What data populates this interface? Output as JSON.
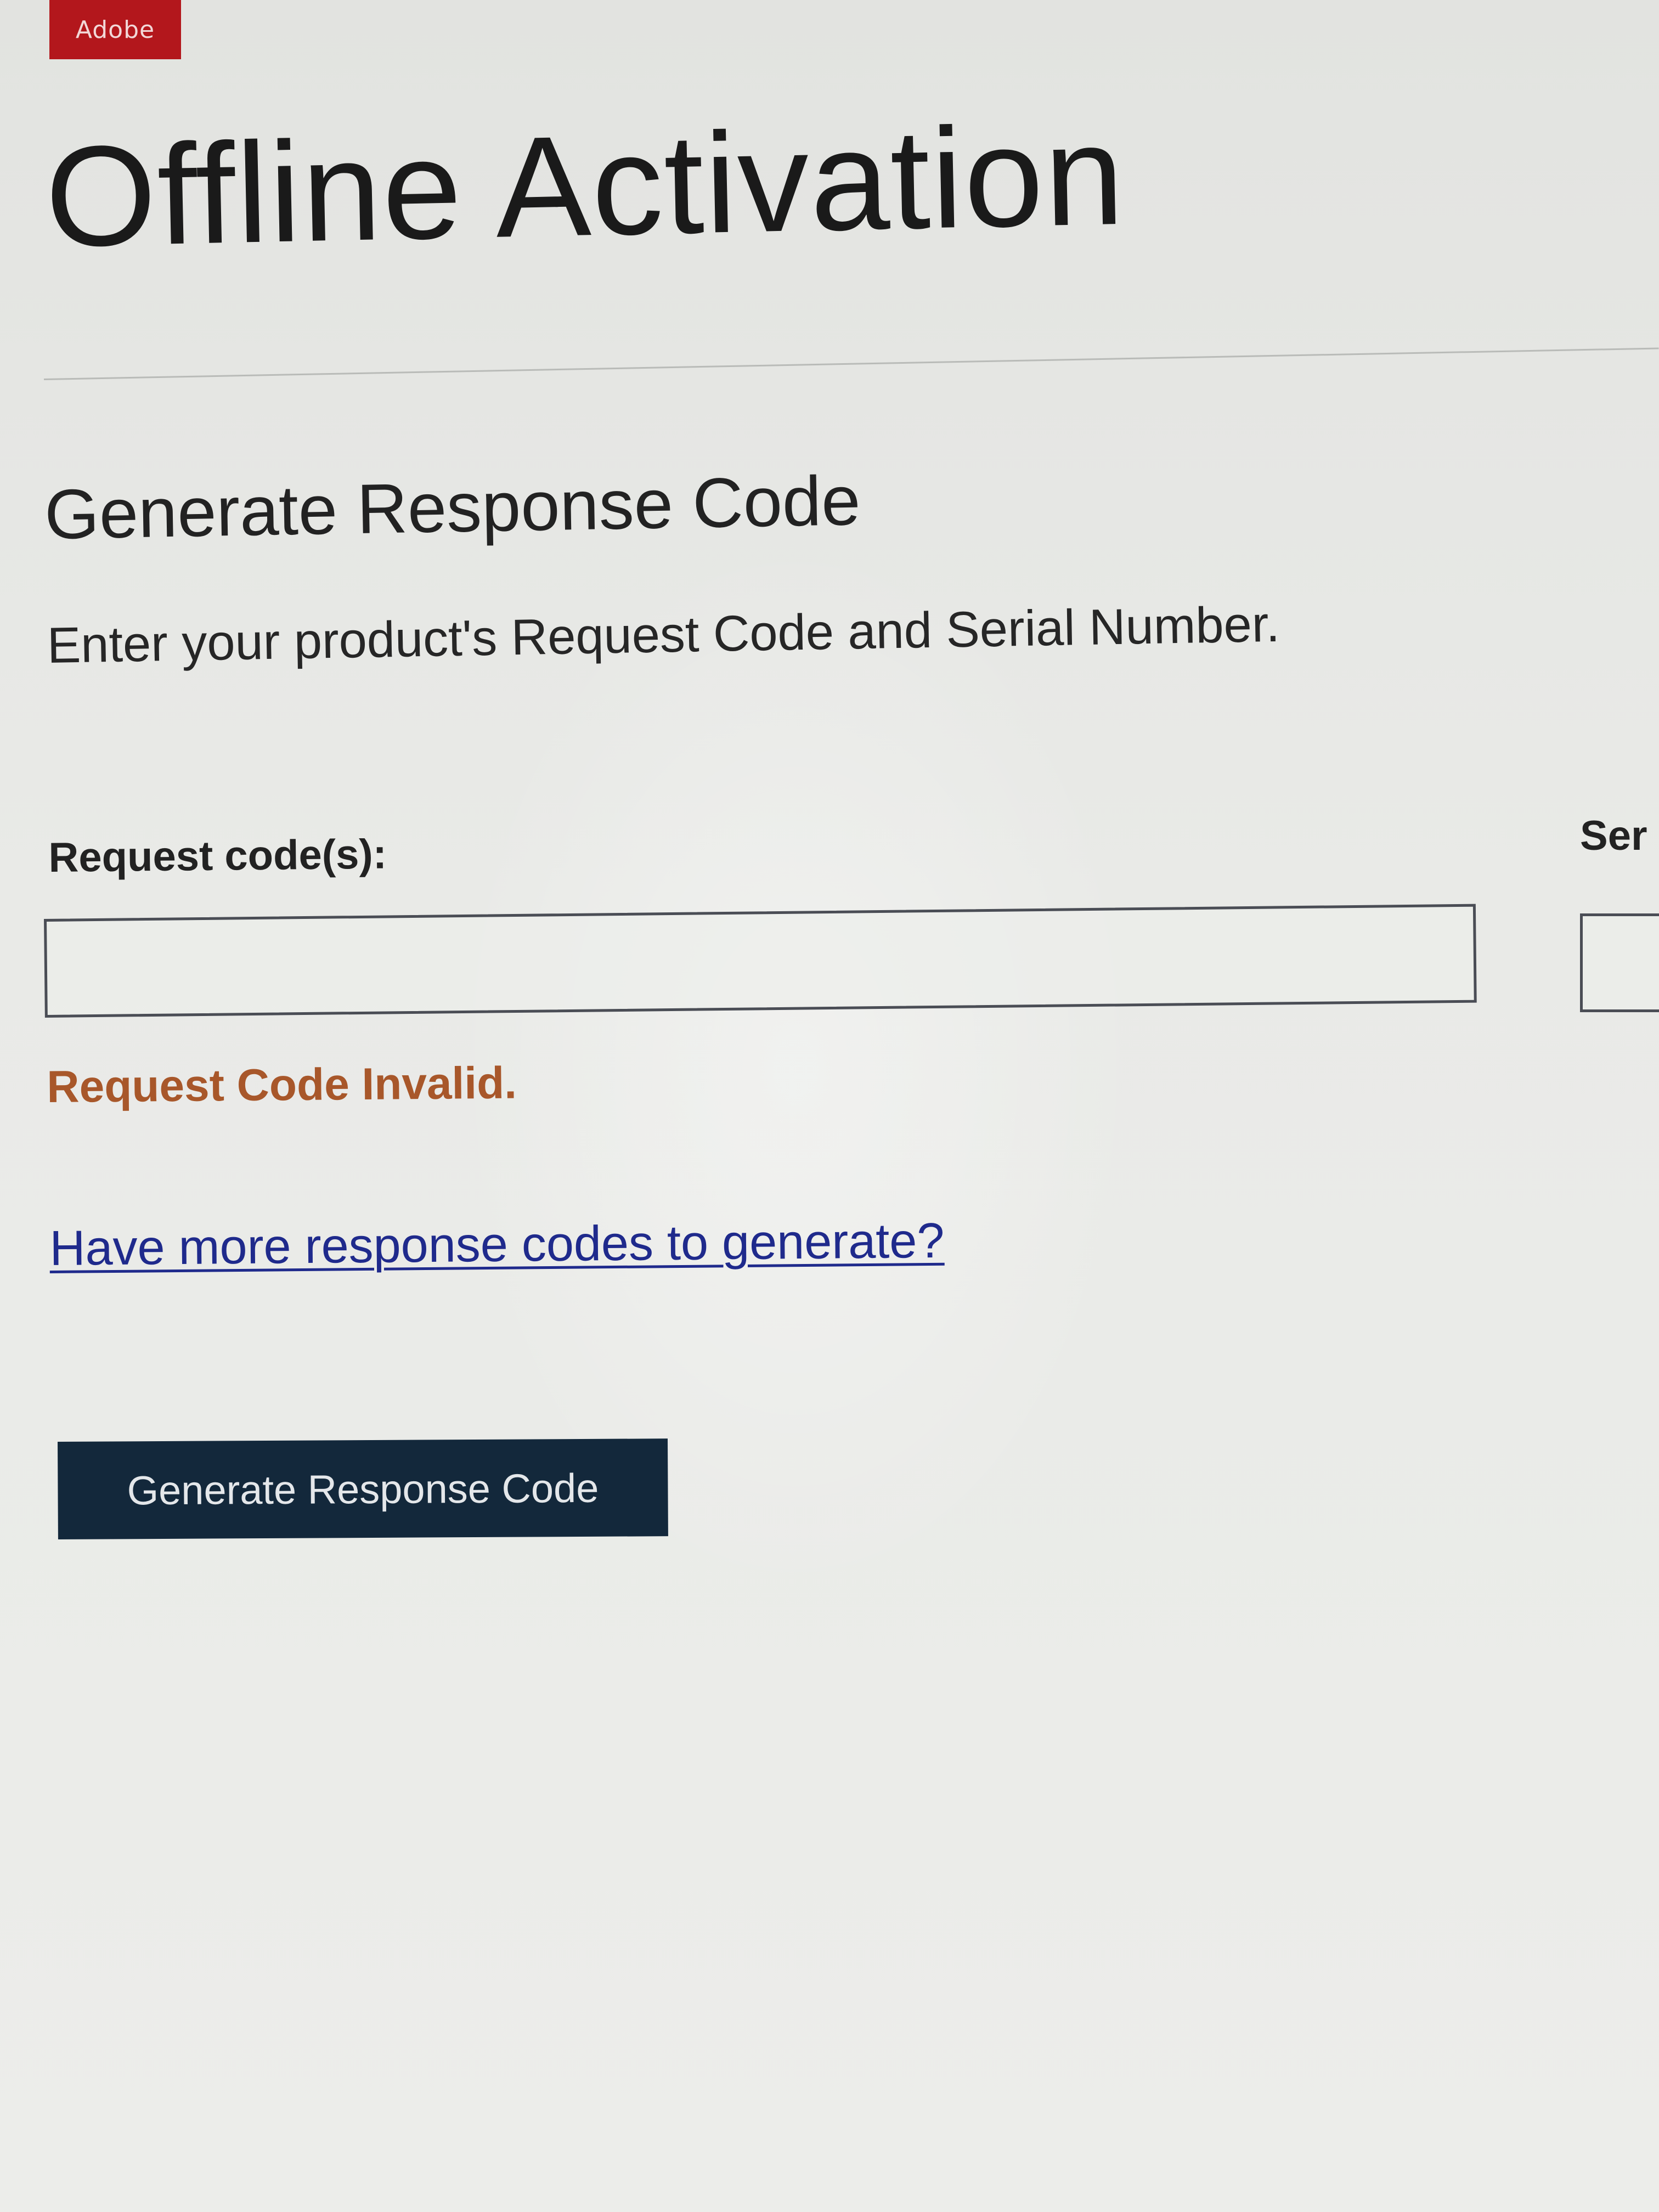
{
  "brand": {
    "logo_text": "Adobe",
    "logo_color": "#b3171c"
  },
  "page": {
    "title": "Offline Activation"
  },
  "section": {
    "heading": "Generate Response Code",
    "instructions": "Enter your product's Request Code and Serial Number."
  },
  "form": {
    "request_label": "Request code(s):",
    "request_value": "",
    "serial_label": "Ser",
    "serial_value": "",
    "error_message": "Request Code Invalid.",
    "error_color": "#a8572a"
  },
  "links": {
    "more_codes": "Have more response codes to generate?"
  },
  "actions": {
    "generate_label": "Generate Response Code",
    "button_color": "#13283b"
  }
}
